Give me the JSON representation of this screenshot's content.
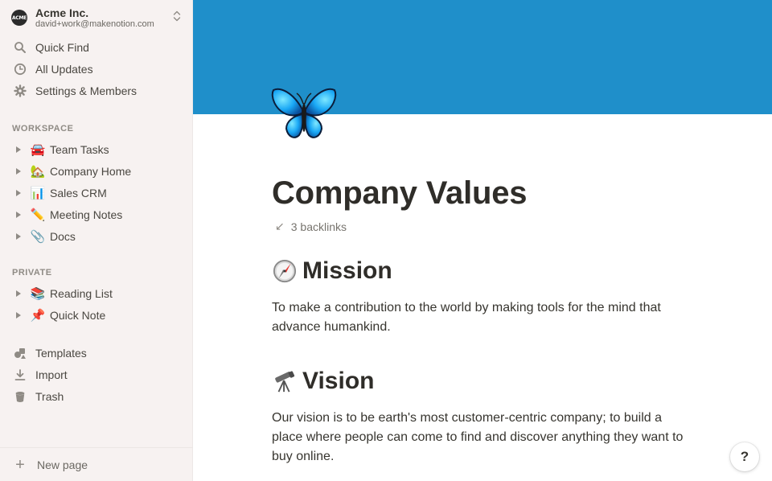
{
  "workspace": {
    "logo_text": "ACME",
    "name": "Acme Inc.",
    "email": "david+work@makenotion.com"
  },
  "nav": {
    "quick_find": "Quick Find",
    "all_updates": "All Updates",
    "settings": "Settings & Members"
  },
  "workspace_section": {
    "label": "WORKSPACE",
    "items": [
      {
        "emoji": "🚘",
        "label": "Team Tasks"
      },
      {
        "emoji": "🏡",
        "label": "Company Home"
      },
      {
        "emoji": "📊",
        "label": "Sales CRM"
      },
      {
        "emoji": "✏️",
        "label": "Meeting Notes"
      },
      {
        "emoji": "📎",
        "label": "Docs"
      }
    ]
  },
  "private_section": {
    "label": "PRIVATE",
    "items": [
      {
        "emoji": "📚",
        "label": "Reading List"
      },
      {
        "emoji": "📌",
        "label": "Quick Note"
      }
    ]
  },
  "tools": {
    "templates": "Templates",
    "import": "Import",
    "trash": "Trash"
  },
  "new_page": "New page",
  "page": {
    "cover_color": "#1f8fca",
    "title": "Company Values",
    "backlinks": "3 backlinks",
    "mission": {
      "heading": "Mission",
      "text": "To make a contribution to the world by making tools for the mind that advance humankind."
    },
    "vision": {
      "heading": "Vision",
      "text": "Our vision is to be earth's most customer-centric company; to build a place where people can come to find and discover anything they want to buy online."
    }
  },
  "help_label": "?"
}
